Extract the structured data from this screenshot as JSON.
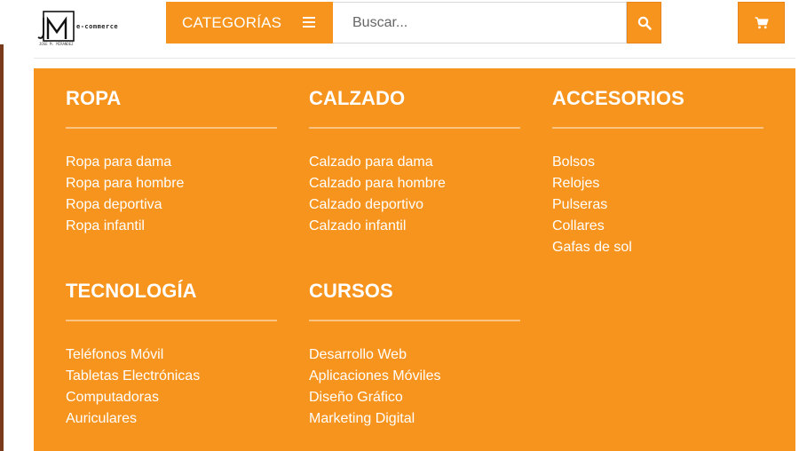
{
  "brand": {
    "logo_mark": "JM",
    "logo_text": "e-commerce",
    "logo_sub": "JOSE M. MIRANDEZ"
  },
  "header": {
    "categories_label": "CATEGORÍAS",
    "search_placeholder": "Buscar...",
    "search_value": ""
  },
  "icons": {
    "menu": "hamburger-icon",
    "search": "search-icon",
    "cart": "cart-icon"
  },
  "colors": {
    "accent": "#f7941d",
    "text_on_accent": "#ffffff"
  },
  "menu": {
    "columns": [
      {
        "title": "ROPA",
        "items": [
          "Ropa para dama",
          "Ropa para hombre",
          "Ropa deportiva",
          "Ropa infantil"
        ]
      },
      {
        "title": "CALZADO",
        "items": [
          "Calzado para dama",
          "Calzado para hombre",
          "Calzado deportivo",
          "Calzado infantil"
        ]
      },
      {
        "title": "ACCESORIOS",
        "items": [
          "Bolsos",
          "Relojes",
          "Pulseras",
          "Collares",
          "Gafas de sol"
        ]
      },
      {
        "title": "TECNOLOGÍA",
        "items": [
          "Teléfonos Móvil",
          "Tabletas Electrónicas",
          "Computadoras",
          "Auriculares"
        ]
      },
      {
        "title": "CURSOS",
        "items": [
          "Desarrollo Web",
          "Aplicaciones Móviles",
          "Diseño Gráfico",
          "Marketing Digital"
        ]
      }
    ]
  }
}
